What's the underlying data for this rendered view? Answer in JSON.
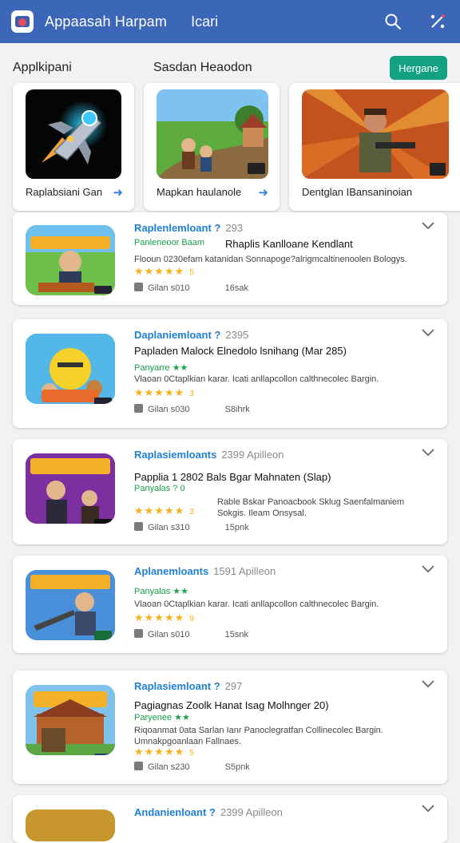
{
  "appbar": {
    "title": "Appaasah Harpam",
    "subtitle": "Icari",
    "search_icon": "search-icon",
    "more_icon": "tools-icon",
    "bg": "#3c67b8"
  },
  "section": {
    "left_title": "Applkipani",
    "right_title": "Sasdan Heaodon",
    "action_label": "Hergane"
  },
  "featured": [
    {
      "label": "Raplabsiani Gan",
      "icon": "rocket-icon"
    },
    {
      "label": "Mapkan haulanole",
      "icon": "village-icon"
    },
    {
      "label": "Dentglan IBansaninoian",
      "icon": "soldier-icon",
      "badge": "39"
    }
  ],
  "apps": [
    {
      "title": "Raplenlemloant ?",
      "year": "293",
      "name": "Rhaplis Kanlloane Kendlant",
      "tag": "Panleneoor Baam",
      "desc": "Flooun 0230efam katanidan Sonnapoge?alrigmcaltinenoolen Bologys.",
      "stars": "★★★★★",
      "rating_count": "5",
      "publisher": "Gilan s010",
      "downloads": "16sak",
      "icon_badge": "83"
    },
    {
      "title": "Daplaniemloant ?",
      "year": "2395",
      "name": "Papladen Malock Elnedolo lsnihang (Mar 285)",
      "tag": "Panyarre ★★",
      "desc": "Vlaoan 0Ctaplkian karar. Icati anllapcollon calthnecolec Bargin.",
      "stars": "★★★★★",
      "rating_count": "3",
      "publisher": "Gilan s030",
      "downloads": "S8ihrk",
      "icon_badge": "83"
    },
    {
      "title": "Raplasiemloants",
      "year": "2399 Apilleon",
      "name": "Papplia 1 2802 Bals Bgar Mahnaten (Slap)",
      "tag": "Panyalas ? 0",
      "desc": "Rable Bskar Panoacbook Sklug Saenfalmaniem Sokgis. Ileam Onsysal.",
      "stars": "★★★★★",
      "rating_count": "3",
      "publisher": "Gilan s310",
      "downloads": "15pnk",
      "icon_badge": "89"
    },
    {
      "title": "Aplanemloants",
      "year": "1591 Apilleon",
      "name": "",
      "tag": "Panyalas ★★",
      "desc": "Vlaoan 0Ctaplkian karar. Icati anllapcollon calthnecolec Bargin.",
      "stars": "★★★★★",
      "rating_count": "9",
      "publisher": "Gilan s010",
      "downloads": "15snk",
      "icon_badge": "83"
    },
    {
      "title": "Raplasiemloant ?",
      "year": "297",
      "name": "Pagiagnas Zoolk Hanat Isag Molhnger 20)",
      "tag": "Paryenee ★★",
      "desc": "Riqoanmat 0ata Sarlan Ianr Panoclegratfan Collinecolec Bargin. Umnakpgoanlaan Fallnaes.",
      "stars": "★★★★★",
      "rating_count": "5",
      "publisher": "Gilan s230",
      "downloads": "S5pnk",
      "icon_badge": "89"
    },
    {
      "title": "Andanienloant ?",
      "year": "2399 Apilleon",
      "name": "",
      "tag": "",
      "desc": "",
      "stars": "",
      "rating_count": "",
      "publisher": "",
      "downloads": "",
      "icon_badge": ""
    }
  ]
}
